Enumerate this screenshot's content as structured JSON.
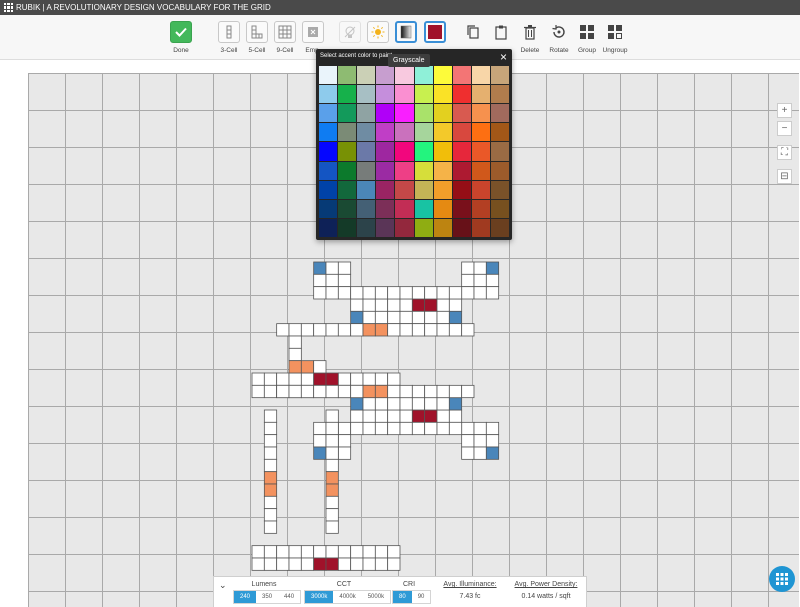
{
  "app": {
    "title": "RUBIK | A REVOLUTIONARY DESIGN VOCABULARY FOR THE GRID"
  },
  "toolbar": {
    "items": [
      {
        "id": "done",
        "label": "Done",
        "icon": "check-icon"
      },
      {
        "id": "three-cell",
        "label": "3-Cell",
        "icon": "three-cell-icon"
      },
      {
        "id": "five-cell",
        "label": "5-Cell",
        "icon": "five-cell-icon"
      },
      {
        "id": "nine-cell",
        "label": "9-Cell",
        "icon": "nine-cell-icon"
      },
      {
        "id": "empty",
        "label": "Emp",
        "icon": "empty-icon"
      },
      {
        "id": "light-off",
        "label": "",
        "icon": "light-off-icon"
      },
      {
        "id": "brightness",
        "label": "",
        "icon": "sun-icon"
      },
      {
        "id": "grayscale",
        "label": "",
        "icon": "grayscale-icon"
      },
      {
        "id": "accent-color",
        "label": "",
        "icon": "accent-swatch-icon"
      },
      {
        "id": "copy",
        "label": "",
        "icon": "copy-icon"
      },
      {
        "id": "paste",
        "label": "",
        "icon": "paste-icon"
      },
      {
        "id": "delete",
        "label": "Delete",
        "icon": "trash-icon"
      },
      {
        "id": "rotate",
        "label": "Rotate",
        "icon": "rotate-icon"
      },
      {
        "id": "group",
        "label": "Group",
        "icon": "group-icon"
      },
      {
        "id": "ungroup",
        "label": "Ungroup",
        "icon": "ungroup-icon"
      }
    ]
  },
  "palette": {
    "title": "Select accent color to paint",
    "close": "×",
    "tooltip": "Grayscale",
    "swatches": [
      [
        "#eaf4fb",
        "#8ebb72",
        "#cbd0b6",
        "#c79ecf",
        "#f8c9df",
        "#8ff0d8",
        "#fdfb3a",
        "#f37575",
        "#f8d6a8",
        "#c7a57a"
      ],
      [
        "#8ecbec",
        "#16b14b",
        "#a7bfc4",
        "#c58edc",
        "#fa8fd1",
        "#c8f04f",
        "#fae226",
        "#ef2f2f",
        "#e5b06f",
        "#b07c4d"
      ],
      [
        "#5aa0ea",
        "#139a5b",
        "#8fa3a3",
        "#b000f8",
        "#f91fff",
        "#a9e26a",
        "#e3d01f",
        "#d85a50",
        "#f6914e",
        "#a16a5d"
      ],
      [
        "#0f7cf2",
        "#7b8b76",
        "#6f8ca3",
        "#c03ec6",
        "#ca71bd",
        "#a6d59c",
        "#f3c92a",
        "#d8483e",
        "#fd6f12",
        "#a25718"
      ],
      [
        "#0506ff",
        "#789105",
        "#6b79a8",
        "#9e27a0",
        "#f2067d",
        "#23f47e",
        "#f1be0a",
        "#e6273b",
        "#ea5828",
        "#9a6b44"
      ],
      [
        "#1455c3",
        "#0c7a2c",
        "#777c7a",
        "#9b2ba3",
        "#ee3f86",
        "#d6de3a",
        "#f5b348",
        "#ad1a31",
        "#d0581b",
        "#9c5b2b"
      ],
      [
        "#0042a8",
        "#12683c",
        "#4b87b8",
        "#9a2463",
        "#c44848",
        "#c4b456",
        "#f29e2a",
        "#950e16",
        "#c9442c",
        "#7a5229"
      ],
      [
        "#063a76",
        "#1a4a33",
        "#446075",
        "#7c2f58",
        "#c22d55",
        "#18c3a3",
        "#e58a12",
        "#79101b",
        "#b33f23",
        "#77501f"
      ],
      [
        "#0e2157",
        "#143a28",
        "#2c434a",
        "#5a3557",
        "#93283d",
        "#8fad12",
        "#bd8411",
        "#671118",
        "#a03a20",
        "#6a3f1f"
      ]
    ]
  },
  "grid": {
    "cells": [
      [
        10,
        2,
        "#4a86ba"
      ],
      [
        10,
        3,
        "#ffffff"
      ],
      [
        10,
        4,
        "#ffffff"
      ],
      [
        11,
        2,
        "#ffffff"
      ],
      [
        11,
        3,
        "#ffffff"
      ],
      [
        11,
        4,
        "#ffffff"
      ],
      [
        12,
        2,
        "#ffffff"
      ],
      [
        12,
        3,
        "#ffffff"
      ],
      [
        12,
        4,
        "#ffffff"
      ],
      [
        10,
        15,
        "#ffffff"
      ],
      [
        10,
        16,
        "#ffffff"
      ],
      [
        10,
        17,
        "#4a86ba"
      ],
      [
        11,
        15,
        "#ffffff"
      ],
      [
        11,
        16,
        "#ffffff"
      ],
      [
        11,
        17,
        "#ffffff"
      ],
      [
        12,
        15,
        "#ffffff"
      ],
      [
        12,
        16,
        "#ffffff"
      ],
      [
        12,
        17,
        "#ffffff"
      ],
      [
        22,
        2,
        "#ffffff"
      ],
      [
        22,
        3,
        "#ffffff"
      ],
      [
        22,
        4,
        "#ffffff"
      ],
      [
        23,
        2,
        "#ffffff"
      ],
      [
        23,
        3,
        "#ffffff"
      ],
      [
        23,
        4,
        "#ffffff"
      ],
      [
        24,
        2,
        "#4a86ba"
      ],
      [
        24,
        3,
        "#ffffff"
      ],
      [
        24,
        4,
        "#ffffff"
      ],
      [
        22,
        15,
        "#ffffff"
      ],
      [
        22,
        16,
        "#ffffff"
      ],
      [
        22,
        17,
        "#ffffff"
      ],
      [
        23,
        15,
        "#ffffff"
      ],
      [
        23,
        16,
        "#ffffff"
      ],
      [
        23,
        17,
        "#ffffff"
      ],
      [
        24,
        15,
        "#ffffff"
      ],
      [
        24,
        16,
        "#ffffff"
      ],
      [
        24,
        17,
        "#4a86ba"
      ],
      [
        5,
        11,
        "#ffffff"
      ],
      [
        6,
        11,
        "#ffffff"
      ],
      [
        7,
        11,
        "#ffffff"
      ],
      [
        8,
        11,
        "#ffffff"
      ],
      [
        9,
        11,
        "#ffffff"
      ],
      [
        10,
        11,
        "#a0122a"
      ],
      [
        11,
        11,
        "#a0122a"
      ],
      [
        12,
        11,
        "#ffffff"
      ],
      [
        13,
        11,
        "#ffffff"
      ],
      [
        14,
        11,
        "#ffffff"
      ],
      [
        15,
        11,
        "#ffffff"
      ],
      [
        16,
        11,
        "#ffffff"
      ],
      [
        5,
        12,
        "#ffffff"
      ],
      [
        6,
        12,
        "#ffffff"
      ],
      [
        7,
        12,
        "#ffffff"
      ],
      [
        8,
        12,
        "#ffffff"
      ],
      [
        9,
        12,
        "#ffffff"
      ],
      [
        10,
        12,
        "#ffffff"
      ],
      [
        11,
        12,
        "#ffffff"
      ],
      [
        12,
        12,
        "#ffffff"
      ],
      [
        13,
        12,
        "#ffffff"
      ],
      [
        14,
        12,
        "#ffffff"
      ],
      [
        15,
        12,
        "#ffffff"
      ],
      [
        16,
        12,
        "#ffffff"
      ],
      [
        5,
        25,
        "#ffffff"
      ],
      [
        6,
        25,
        "#ffffff"
      ],
      [
        7,
        25,
        "#ffffff"
      ],
      [
        8,
        25,
        "#ffffff"
      ],
      [
        9,
        25,
        "#ffffff"
      ],
      [
        10,
        25,
        "#ffffff"
      ],
      [
        11,
        25,
        "#ffffff"
      ],
      [
        12,
        25,
        "#ffffff"
      ],
      [
        13,
        25,
        "#ffffff"
      ],
      [
        14,
        25,
        "#ffffff"
      ],
      [
        15,
        25,
        "#ffffff"
      ],
      [
        16,
        25,
        "#ffffff"
      ],
      [
        5,
        26,
        "#ffffff"
      ],
      [
        6,
        26,
        "#ffffff"
      ],
      [
        7,
        26,
        "#ffffff"
      ],
      [
        8,
        26,
        "#ffffff"
      ],
      [
        9,
        26,
        "#ffffff"
      ],
      [
        10,
        26,
        "#a0122a"
      ],
      [
        11,
        26,
        "#a0122a"
      ],
      [
        12,
        26,
        "#ffffff"
      ],
      [
        13,
        26,
        "#ffffff"
      ],
      [
        14,
        26,
        "#ffffff"
      ],
      [
        15,
        26,
        "#ffffff"
      ],
      [
        16,
        26,
        "#ffffff"
      ],
      [
        13,
        5,
        "#ffffff"
      ],
      [
        14,
        5,
        "#ffffff"
      ],
      [
        15,
        5,
        "#ffffff"
      ],
      [
        16,
        5,
        "#ffffff"
      ],
      [
        17,
        5,
        "#ffffff"
      ],
      [
        18,
        5,
        "#a0122a"
      ],
      [
        19,
        5,
        "#a0122a"
      ],
      [
        20,
        5,
        "#ffffff"
      ],
      [
        21,
        5,
        "#ffffff"
      ],
      [
        13,
        14,
        "#ffffff"
      ],
      [
        14,
        14,
        "#ffffff"
      ],
      [
        15,
        14,
        "#ffffff"
      ],
      [
        16,
        14,
        "#ffffff"
      ],
      [
        17,
        14,
        "#ffffff"
      ],
      [
        18,
        14,
        "#a0122a"
      ],
      [
        19,
        14,
        "#a0122a"
      ],
      [
        20,
        14,
        "#ffffff"
      ],
      [
        21,
        14,
        "#ffffff"
      ],
      [
        13,
        4,
        "#ffffff"
      ],
      [
        14,
        4,
        "#ffffff"
      ],
      [
        15,
        4,
        "#ffffff"
      ],
      [
        16,
        4,
        "#ffffff"
      ],
      [
        17,
        4,
        "#ffffff"
      ],
      [
        18,
        4,
        "#ffffff"
      ],
      [
        19,
        4,
        "#ffffff"
      ],
      [
        20,
        4,
        "#ffffff"
      ],
      [
        21,
        4,
        "#ffffff"
      ],
      [
        13,
        15,
        "#ffffff"
      ],
      [
        14,
        15,
        "#ffffff"
      ],
      [
        15,
        15,
        "#ffffff"
      ],
      [
        16,
        15,
        "#ffffff"
      ],
      [
        17,
        15,
        "#ffffff"
      ],
      [
        18,
        15,
        "#ffffff"
      ],
      [
        19,
        15,
        "#ffffff"
      ],
      [
        20,
        15,
        "#ffffff"
      ],
      [
        21,
        15,
        "#ffffff"
      ],
      [
        13,
        6,
        "#4a86ba"
      ],
      [
        14,
        6,
        "#ffffff"
      ],
      [
        15,
        6,
        "#ffffff"
      ],
      [
        16,
        6,
        "#ffffff"
      ],
      [
        17,
        6,
        "#ffffff"
      ],
      [
        18,
        6,
        "#ffffff"
      ],
      [
        19,
        6,
        "#ffffff"
      ],
      [
        20,
        6,
        "#ffffff"
      ],
      [
        21,
        6,
        "#4a86ba"
      ],
      [
        13,
        13,
        "#4a86ba"
      ],
      [
        14,
        13,
        "#ffffff"
      ],
      [
        15,
        13,
        "#ffffff"
      ],
      [
        16,
        13,
        "#ffffff"
      ],
      [
        17,
        13,
        "#ffffff"
      ],
      [
        18,
        13,
        "#ffffff"
      ],
      [
        19,
        13,
        "#ffffff"
      ],
      [
        20,
        13,
        "#ffffff"
      ],
      [
        21,
        13,
        "#4a86ba"
      ],
      [
        7,
        7,
        "#ffffff"
      ],
      [
        8,
        7,
        "#ffffff"
      ],
      [
        9,
        7,
        "#ffffff"
      ],
      [
        10,
        7,
        "#ffffff"
      ],
      [
        11,
        7,
        "#ffffff"
      ],
      [
        12,
        7,
        "#ffffff"
      ],
      [
        13,
        7,
        "#ffffff"
      ],
      [
        14,
        7,
        "#f3925f"
      ],
      [
        15,
        7,
        "#f3925f"
      ],
      [
        16,
        7,
        "#ffffff"
      ],
      [
        17,
        7,
        "#ffffff"
      ],
      [
        18,
        7,
        "#ffffff"
      ],
      [
        19,
        7,
        "#ffffff"
      ],
      [
        20,
        7,
        "#ffffff"
      ],
      [
        21,
        7,
        "#ffffff"
      ],
      [
        22,
        7,
        "#ffffff"
      ],
      [
        7,
        12,
        "#ffffff"
      ],
      [
        8,
        12,
        "#ffffff"
      ],
      [
        9,
        12,
        "#ffffff"
      ],
      [
        10,
        12,
        "#ffffff"
      ],
      [
        11,
        12,
        "#ffffff"
      ],
      [
        12,
        12,
        "#ffffff"
      ],
      [
        13,
        12,
        "#ffffff"
      ],
      [
        14,
        12,
        "#f3925f"
      ],
      [
        15,
        12,
        "#f3925f"
      ],
      [
        16,
        12,
        "#ffffff"
      ],
      [
        17,
        12,
        "#ffffff"
      ],
      [
        18,
        12,
        "#ffffff"
      ],
      [
        19,
        12,
        "#ffffff"
      ],
      [
        20,
        12,
        "#ffffff"
      ],
      [
        21,
        12,
        "#ffffff"
      ],
      [
        22,
        12,
        "#ffffff"
      ],
      [
        6,
        14,
        "#ffffff"
      ],
      [
        6,
        15,
        "#ffffff"
      ],
      [
        6,
        16,
        "#ffffff"
      ],
      [
        6,
        17,
        "#ffffff"
      ],
      [
        6,
        18,
        "#ffffff"
      ],
      [
        6,
        19,
        "#f3925f"
      ],
      [
        6,
        20,
        "#f3925f"
      ],
      [
        6,
        21,
        "#ffffff"
      ],
      [
        6,
        22,
        "#ffffff"
      ],
      [
        6,
        23,
        "#ffffff"
      ],
      [
        11,
        14,
        "#ffffff"
      ],
      [
        11,
        15,
        "#ffffff"
      ],
      [
        11,
        16,
        "#ffffff"
      ],
      [
        11,
        17,
        "#ffffff"
      ],
      [
        11,
        18,
        "#ffffff"
      ],
      [
        11,
        19,
        "#f3925f"
      ],
      [
        11,
        20,
        "#f3925f"
      ],
      [
        11,
        21,
        "#ffffff"
      ],
      [
        11,
        22,
        "#ffffff"
      ],
      [
        11,
        23,
        "#ffffff"
      ],
      [
        8,
        8,
        "#ffffff"
      ],
      [
        8,
        9,
        "#ffffff"
      ],
      [
        8,
        10,
        "#f3925f"
      ],
      [
        9,
        10,
        "#f3925f"
      ],
      [
        10,
        10,
        "#ffffff"
      ]
    ]
  },
  "side_buttons": [
    {
      "id": "zoom-in",
      "glyph": "+"
    },
    {
      "id": "zoom-out",
      "glyph": "−"
    },
    {
      "id": "fit",
      "glyph": "⛶"
    },
    {
      "id": "ruler",
      "glyph": "⊟"
    }
  ],
  "bottom": {
    "collapse_glyph": "⌄",
    "lumens": {
      "label": "Lumens",
      "options": [
        "240",
        "350",
        "440"
      ],
      "active": 0
    },
    "cct": {
      "label": "CCT",
      "options": [
        "3000k",
        "4000k",
        "5000k"
      ],
      "active": 0
    },
    "cri": {
      "label": "CRI",
      "options": [
        "80",
        "90"
      ],
      "active": 0
    },
    "illuminance": {
      "label": "Avg. Illuminance:",
      "value": "7.43 fc"
    },
    "power": {
      "label": "Avg. Power Density:",
      "value": "0.14 watts / sqft"
    }
  },
  "colors": {
    "accent": "#2e9ad6",
    "blue_cell": "#4a86ba",
    "red_cell": "#a0122a",
    "orange_cell": "#f3925f",
    "done_green": "#43b85b"
  }
}
